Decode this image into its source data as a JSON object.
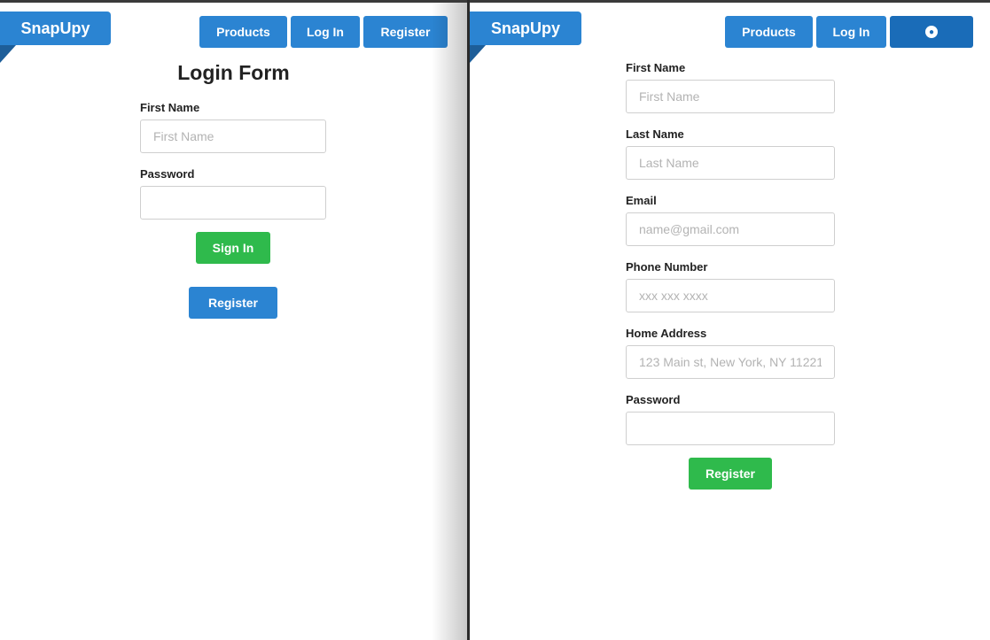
{
  "left": {
    "logo": "SnapUpy",
    "nav": {
      "products": "Products",
      "login": "Log In",
      "register": "Register"
    },
    "title": "Login Form",
    "fields": {
      "first_name": {
        "label": "First Name",
        "placeholder": "First Name",
        "value": ""
      },
      "password": {
        "label": "Password",
        "placeholder": "",
        "value": ""
      }
    },
    "buttons": {
      "sign_in": "Sign In",
      "register": "Register"
    }
  },
  "right": {
    "logo": "SnapUpy",
    "nav": {
      "products": "Products",
      "login": "Log In",
      "accessibility_icon": "accessibility-icon"
    },
    "fields": {
      "first_name": {
        "label": "First Name",
        "placeholder": "First Name"
      },
      "last_name": {
        "label": "Last Name",
        "placeholder": "Last Name"
      },
      "email": {
        "label": "Email",
        "placeholder": "name@gmail.com"
      },
      "phone": {
        "label": "Phone Number",
        "placeholder": "xxx xxx xxxx"
      },
      "address": {
        "label": "Home Address",
        "placeholder": "123 Main st, New York, NY 11221"
      },
      "password": {
        "label": "Password",
        "placeholder": ""
      }
    },
    "buttons": {
      "register": "Register"
    }
  },
  "colors": {
    "primary": "#2b84d2",
    "success": "#2fba4c",
    "text": "#222222"
  }
}
